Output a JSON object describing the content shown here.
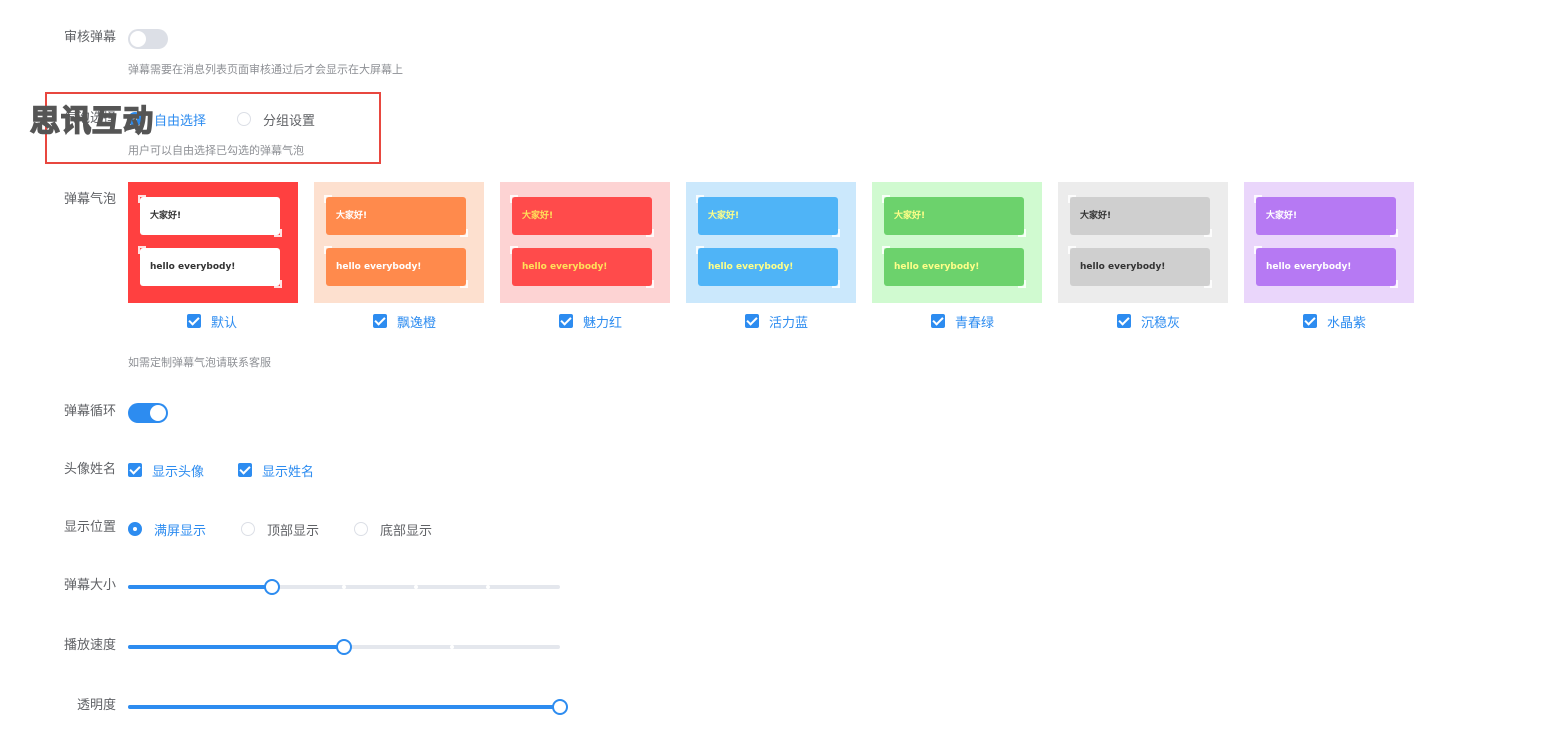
{
  "review": {
    "label": "审核弹幕",
    "enabled": false,
    "hint": "弹幕需要在消息列表页面审核通过后才会显示在大屏幕上"
  },
  "selection": {
    "label": "气泡选择",
    "options": [
      {
        "label": "自由选择",
        "checked": true
      },
      {
        "label": "分组设置",
        "checked": false
      }
    ],
    "hint": "用户可以自由选择已勾选的弹幕气泡"
  },
  "watermark": "思讯互动",
  "bubbles": {
    "label": "弹幕气泡",
    "sample_line1": "大家好!",
    "sample_line2": "hello everybody!",
    "hint": "如需定制弹幕气泡请联系客服",
    "items": [
      {
        "name": "默认",
        "checked": true,
        "bg": "#ff4040",
        "bubble": "#ffffff",
        "text": "#333333"
      },
      {
        "name": "飘逸橙",
        "checked": true,
        "bg": "#fde0cf",
        "bubble": "#ff8a4c",
        "text": "#ffffff"
      },
      {
        "name": "魅力红",
        "checked": true,
        "bg": "#fdd3d3",
        "bubble": "#ff4b4b",
        "text": "#ffe15a"
      },
      {
        "name": "活力蓝",
        "checked": true,
        "bg": "#cbe8fc",
        "bubble": "#4fb4f7",
        "text": "#ffff88"
      },
      {
        "name": "青春绿",
        "checked": true,
        "bg": "#d0fad0",
        "bubble": "#6cd26c",
        "text": "#ffff88"
      },
      {
        "name": "沉稳灰",
        "checked": true,
        "bg": "#ececec",
        "bubble": "#cfcfcf",
        "text": "#333333"
      },
      {
        "name": "水晶紫",
        "checked": true,
        "bg": "#ead6fb",
        "bubble": "#b679f3",
        "text": "#ffffff"
      }
    ]
  },
  "loop": {
    "label": "弹幕循环",
    "enabled": true
  },
  "avatar": {
    "label": "头像姓名",
    "options": [
      {
        "label": "显示头像",
        "checked": true
      },
      {
        "label": "显示姓名",
        "checked": true
      }
    ]
  },
  "position": {
    "label": "显示位置",
    "options": [
      {
        "label": "满屏显示",
        "checked": true
      },
      {
        "label": "顶部显示",
        "checked": false
      },
      {
        "label": "底部显示",
        "checked": false
      }
    ]
  },
  "size": {
    "label": "弹幕大小",
    "value_fraction": 0.333,
    "stop_fractions": [
      0.5,
      0.667,
      0.833
    ]
  },
  "speed": {
    "label": "播放速度",
    "value_fraction": 0.5,
    "stop_fractions": [
      0.75
    ]
  },
  "opacity": {
    "label": "透明度",
    "value_fraction": 1.0,
    "stop_fractions": []
  },
  "colors": {
    "primary": "#2d8cf0",
    "border_highlight": "#e8473f"
  }
}
